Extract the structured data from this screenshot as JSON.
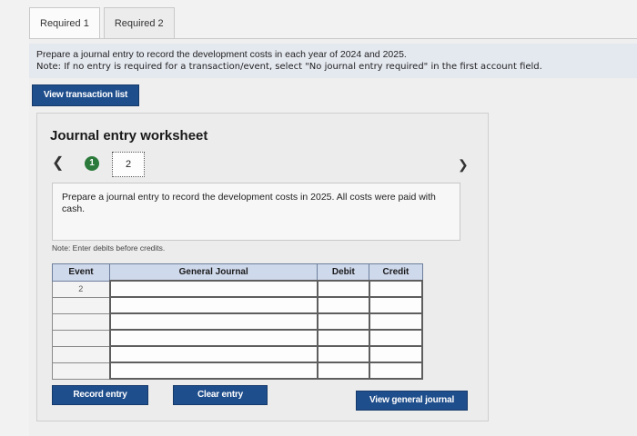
{
  "tabs": [
    {
      "label": "Required 1",
      "active": true
    },
    {
      "label": "Required 2",
      "active": false
    }
  ],
  "instructions": {
    "text": "Prepare a journal entry to record the development costs in each year of 2024 and 2025.",
    "note": "Note: If no entry is required for a transaction/event, select \"No journal entry required\" in the first account field."
  },
  "view_transaction_label": "View transaction list",
  "worksheet": {
    "title": "Journal entry worksheet",
    "prev_icon": "chevron-left-icon",
    "next_icon": "chevron-right-icon",
    "completed_step": "1",
    "current_step": "2",
    "prompt": "Prepare a journal entry to record the development costs in 2025. All costs were paid with cash.",
    "debits_note": "Note: Enter debits before credits."
  },
  "journal_table": {
    "headers": {
      "event": "Event",
      "general_journal": "General Journal",
      "debit": "Debit",
      "credit": "Credit"
    },
    "rows": [
      {
        "event": "2",
        "account": "",
        "debit": "",
        "credit": ""
      },
      {
        "event": "",
        "account": "",
        "debit": "",
        "credit": ""
      },
      {
        "event": "",
        "account": "",
        "debit": "",
        "credit": ""
      },
      {
        "event": "",
        "account": "",
        "debit": "",
        "credit": ""
      },
      {
        "event": "",
        "account": "",
        "debit": "",
        "credit": ""
      },
      {
        "event": "",
        "account": "",
        "debit": "",
        "credit": ""
      }
    ]
  },
  "actions": {
    "record": "Record entry",
    "clear": "Clear entry",
    "view_journal": "View general journal"
  },
  "colors": {
    "button_blue": "#1f4e8c",
    "step_done_green": "#2c7a3b",
    "header_blue": "#cfd9ec",
    "instruction_bg": "#e4e8ef"
  }
}
